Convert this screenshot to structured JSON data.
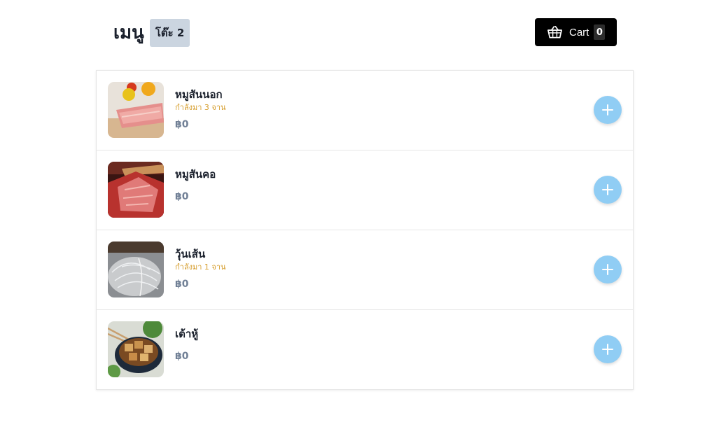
{
  "header": {
    "title": "เมนู",
    "table_label": "โต๊ะ 2",
    "cart": {
      "label": "Cart",
      "count": "0",
      "icon": "basket-icon"
    }
  },
  "colors": {
    "cart_bg": "#000000",
    "badge_bg": "#cbd5e0",
    "status_text": "#d69e2e",
    "price_text": "#718096",
    "add_button": "#90cdf4"
  },
  "menu": {
    "items": [
      {
        "name": "หมูสันนอก",
        "status": "กำลังมา 3 จาน",
        "price": "฿0",
        "image": "pork-loin-photo"
      },
      {
        "name": "หมูสันคอ",
        "status": "",
        "price": "฿0",
        "image": "pork-neck-photo"
      },
      {
        "name": "วุ้นเส้น",
        "status": "กำลังมา 1 จาน",
        "price": "฿0",
        "image": "glass-noodle-photo"
      },
      {
        "name": "เต้าหู้",
        "status": "",
        "price": "฿0",
        "image": "tofu-photo"
      }
    ]
  }
}
